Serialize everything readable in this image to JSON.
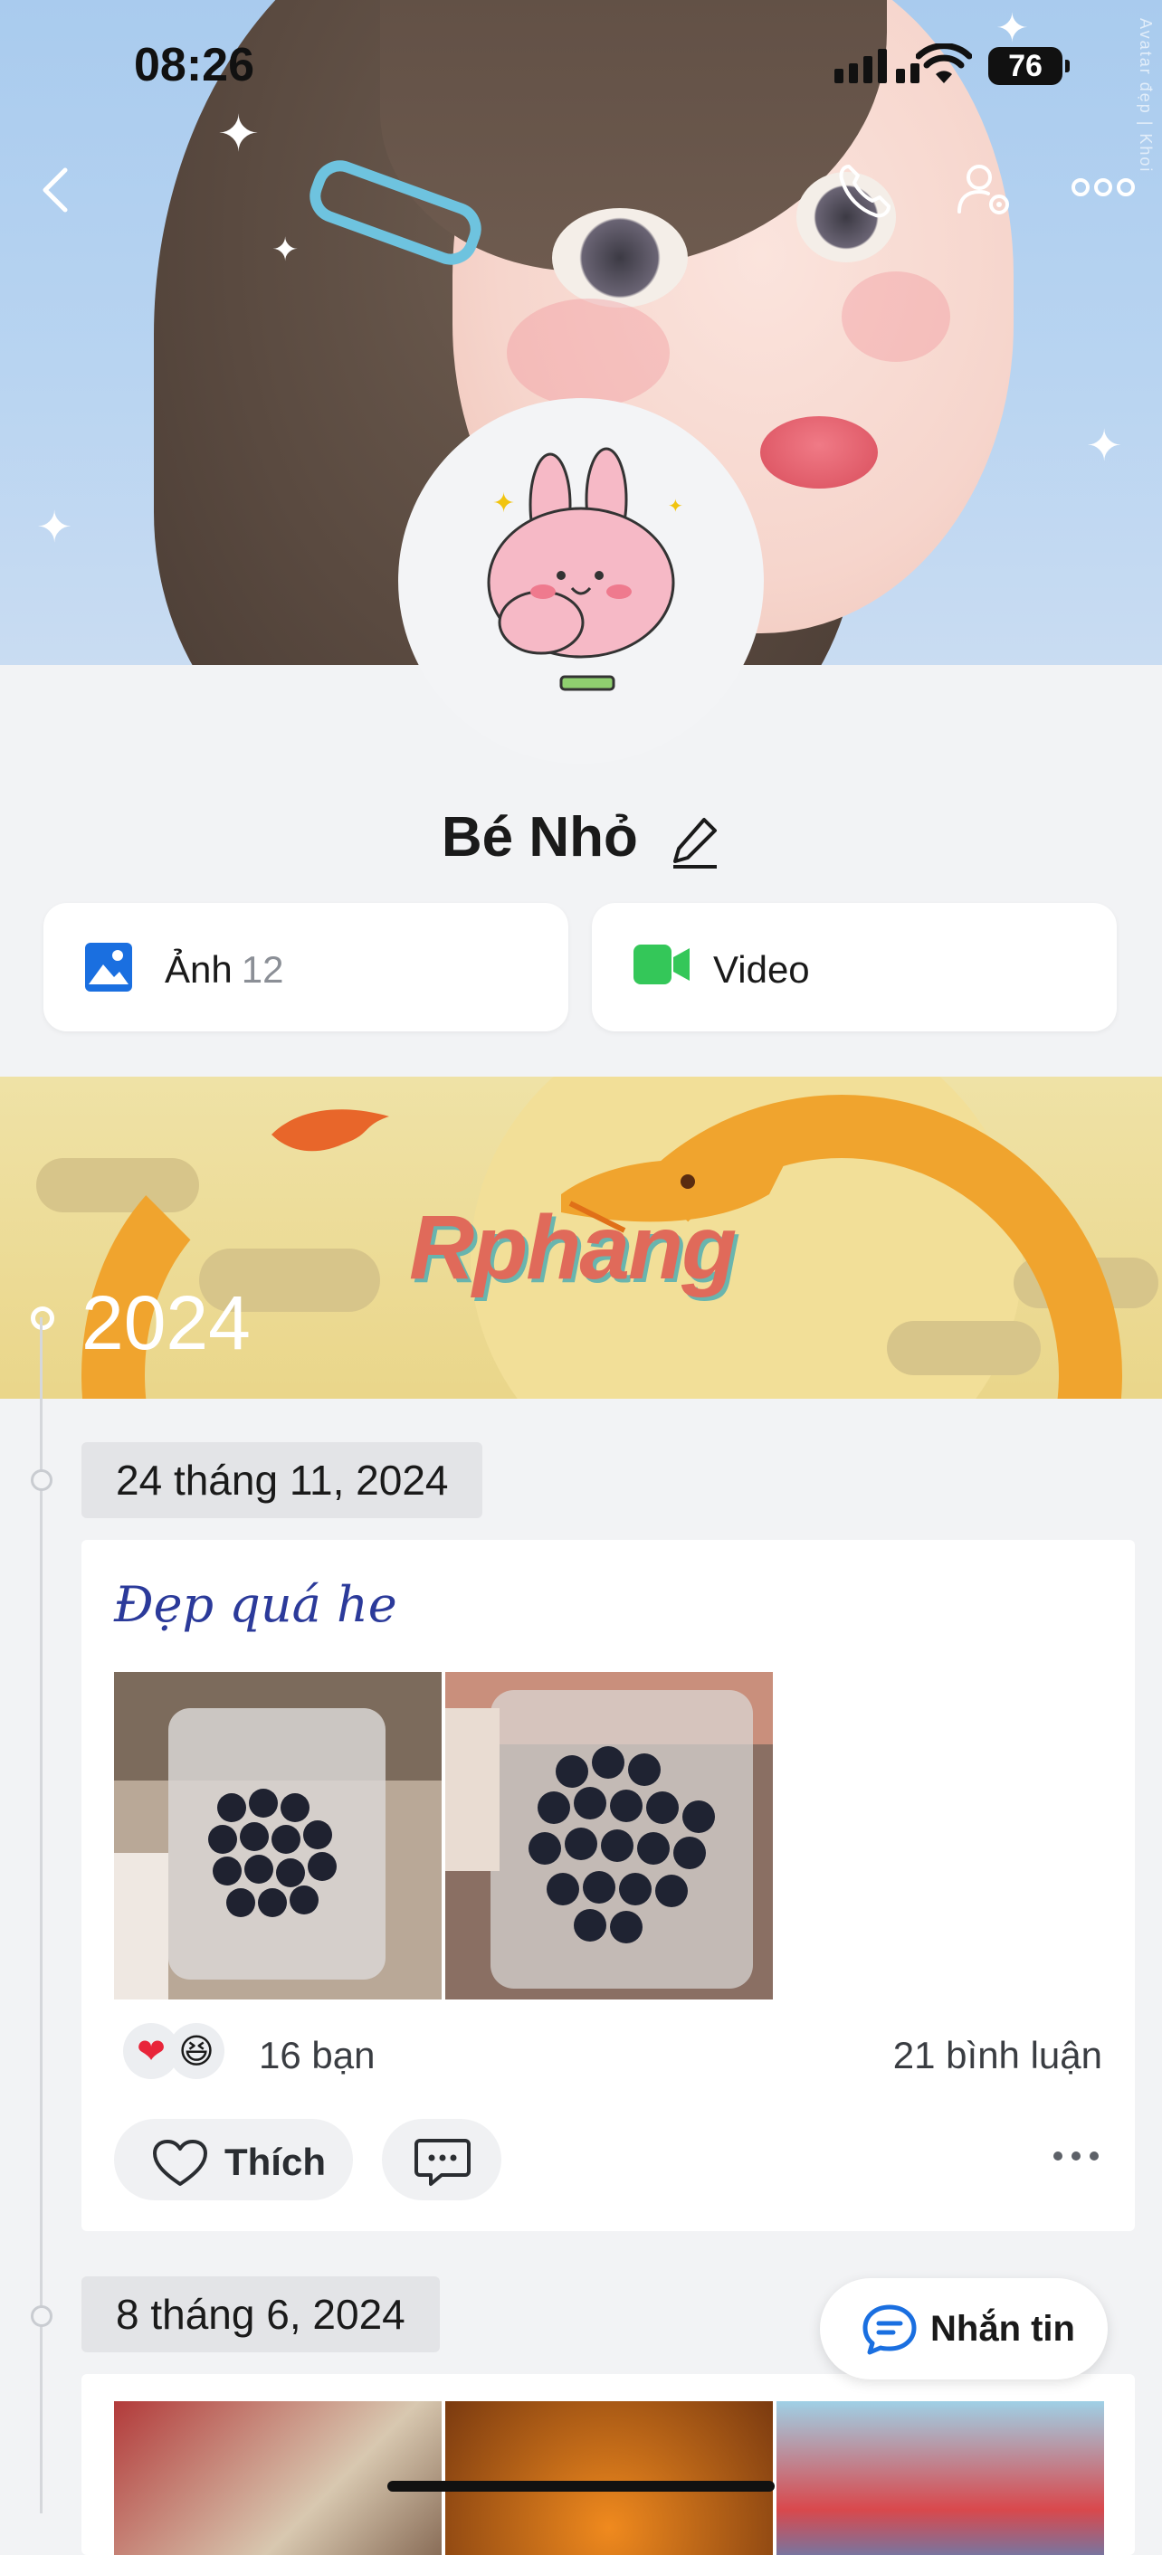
{
  "status_bar": {
    "time": "08:26",
    "battery": "76"
  },
  "cover": {
    "watermark": "Avatar đẹp | Khoi"
  },
  "profile": {
    "name": "Bé Nhỏ"
  },
  "media": {
    "photos": {
      "label": "Ảnh",
      "count": "12"
    },
    "video": {
      "label": "Video"
    }
  },
  "timeline": {
    "year_banner": {
      "year": "2024",
      "wordmark": "Rphang"
    },
    "posts": [
      {
        "date": "24 tháng 11, 2024",
        "caption": "Đẹp quá he",
        "reactions": [
          "heart",
          "laughing"
        ],
        "reaction_count": "16 bạn",
        "comment_count": "21 bình luận",
        "like_label": "Thích"
      },
      {
        "date": "8 tháng 6, 2024"
      }
    ]
  },
  "fab": {
    "label": "Nhắn tin"
  },
  "colors": {
    "accent": "#1a6fe0",
    "video_green": "#34c759",
    "like_red": "#e8253a"
  }
}
